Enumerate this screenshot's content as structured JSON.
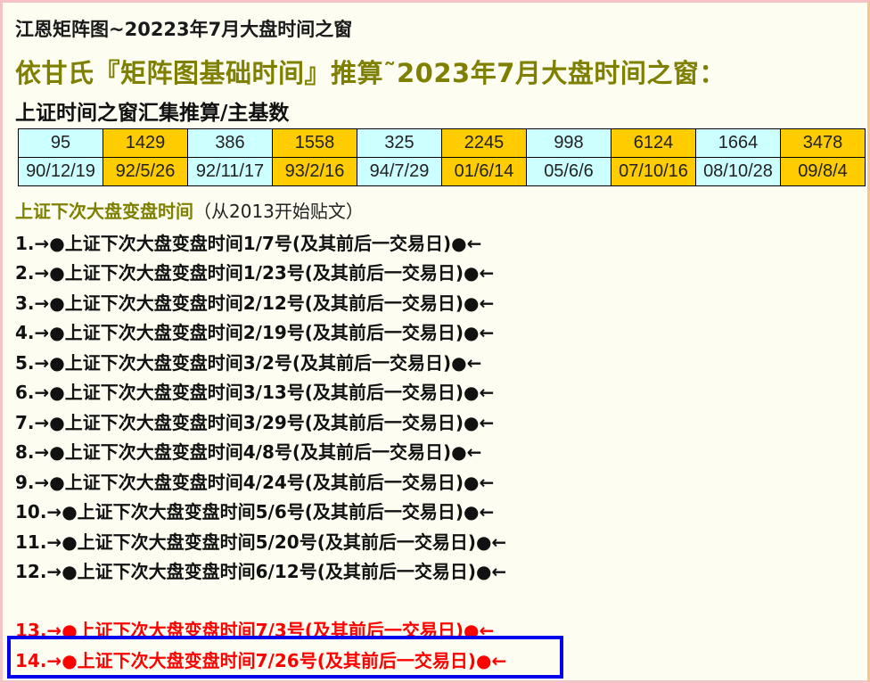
{
  "header": {
    "title_small": "江恩矩阵图~20223年7月大盘时间之窗",
    "title_big": "依甘氏『矩阵图基础时间』推算˜2023年7月大盘时间之窗：",
    "subtitle": "上证时间之窗汇集推算/主基数"
  },
  "basis_table": {
    "row_numbers": [
      "95",
      "1429",
      "386",
      "1558",
      "325",
      "2245",
      "998",
      "6124",
      "1664",
      "3478"
    ],
    "row_dates": [
      "90/12/19",
      "92/5/26",
      "92/11/17",
      "93/2/16",
      "94/7/29",
      "01/6/14",
      "05/6/6",
      "07/10/16",
      "08/10/28",
      "09/8/4"
    ],
    "colors": {
      "cyan": "#ccffff",
      "gold": "#ffcc00"
    }
  },
  "section": {
    "heading": "上证下次大盘变盘时间",
    "note": "（从2013开始贴文）"
  },
  "items": [
    "1.→●上证下次大盘变盘时间1/7号(及其前后一交易日)●←",
    "2.→●上证下次大盘变盘时间1/23号(及其前后一交易日)●←",
    "3.→●上证下次大盘变盘时间2/12号(及其前后一交易日)●←",
    "4.→●上证下次大盘变盘时间2/19号(及其前后一交易日)●←",
    "5.→●上证下次大盘变盘时间3/2号(及其前后一交易日)●←",
    "6.→●上证下次大盘变盘时间3/13号(及其前后一交易日)●←",
    "7.→●上证下次大盘变盘时间3/29号(及其前后一交易日)●←",
    "8.→●上证下次大盘变盘时间4/8号(及其前后一交易日)●←",
    "9.→●上证下次大盘变盘时间4/24号(及其前后一交易日)●←",
    "10.→●上证下次大盘变盘时间5/6号(及其前后一交易日)●←",
    "11.→●上证下次大盘变盘时间5/20号(及其前后一交易日)●←",
    "12.→●上证下次大盘变盘时间6/12号(及其前后一交易日)●←",
    "13.→●上证下次大盘变盘时间7/3号(及其前后一交易日)●←",
    "14.→●上证下次大盘变盘时间7/26号(及其前后一交易日)●←"
  ],
  "accent_colors": {
    "olive": "#808000",
    "red": "#ff0000",
    "highlight_border": "#0000ee"
  }
}
